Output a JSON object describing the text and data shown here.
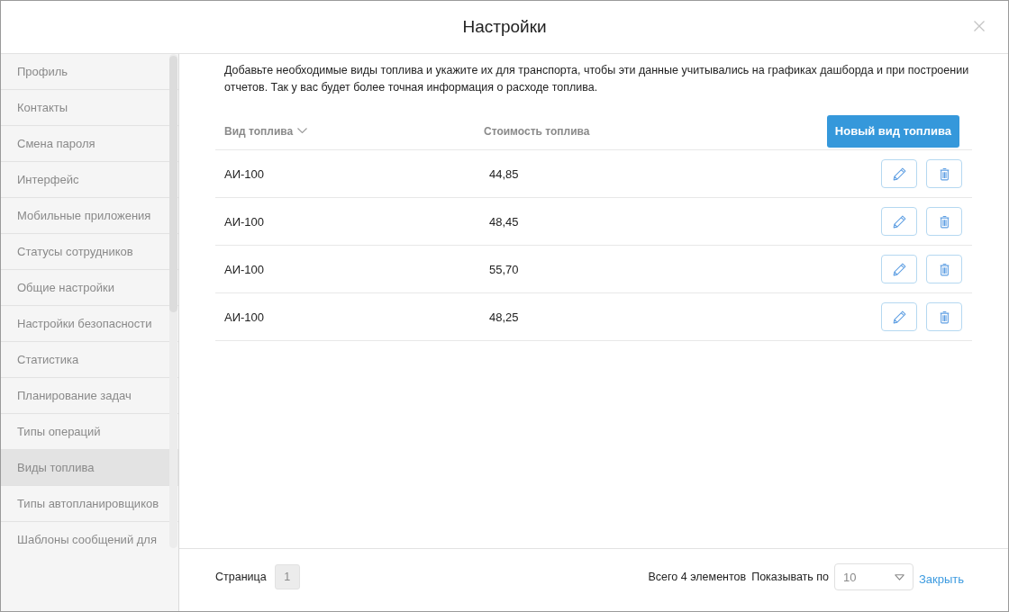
{
  "dialog": {
    "title": "Настройки"
  },
  "sidebar": {
    "items": [
      {
        "label": "Профиль",
        "selected": false
      },
      {
        "label": "Контакты",
        "selected": false
      },
      {
        "label": "Смена пароля",
        "selected": false
      },
      {
        "label": "Интерфейс",
        "selected": false
      },
      {
        "label": "Мобильные приложения",
        "selected": false
      },
      {
        "label": "Статусы сотрудников",
        "selected": false
      },
      {
        "label": "Общие настройки",
        "selected": false
      },
      {
        "label": "Настройки безопасности",
        "selected": false
      },
      {
        "label": "Статистика",
        "selected": false
      },
      {
        "label": "Планирование задач",
        "selected": false
      },
      {
        "label": "Типы операций",
        "selected": false
      },
      {
        "label": "Виды топлива",
        "selected": true
      },
      {
        "label": "Типы автопланировщиков",
        "selected": false
      },
      {
        "label": "Шаблоны сообщений для",
        "selected": false
      }
    ]
  },
  "description": "Добавьте необходимые виды топлива и укажите их для транспорта, чтобы эти данные учитывались на графиках дашборда и при построении отчетов. Так у вас будет более точная информация о расходе топлива.",
  "table": {
    "columns": [
      {
        "label": "Вид топлива",
        "sorted": true
      },
      {
        "label": "Стоимость топлива",
        "sorted": false
      }
    ],
    "new_button": "Новый вид топлива",
    "rows": [
      {
        "fuel": "АИ-100",
        "cost": "44,85"
      },
      {
        "fuel": "АИ-100",
        "cost": "48,45"
      },
      {
        "fuel": "АИ-100",
        "cost": "55,70"
      },
      {
        "fuel": "АИ-100",
        "cost": "48,25"
      }
    ]
  },
  "pagination": {
    "page_label": "Страница",
    "pages": [
      {
        "label": "1",
        "selected": true
      }
    ],
    "total": "Всего 4 элементов",
    "page_size_label": "Показывать по",
    "page_size": "10"
  },
  "footer": {
    "close_link": "Закрыть"
  }
}
